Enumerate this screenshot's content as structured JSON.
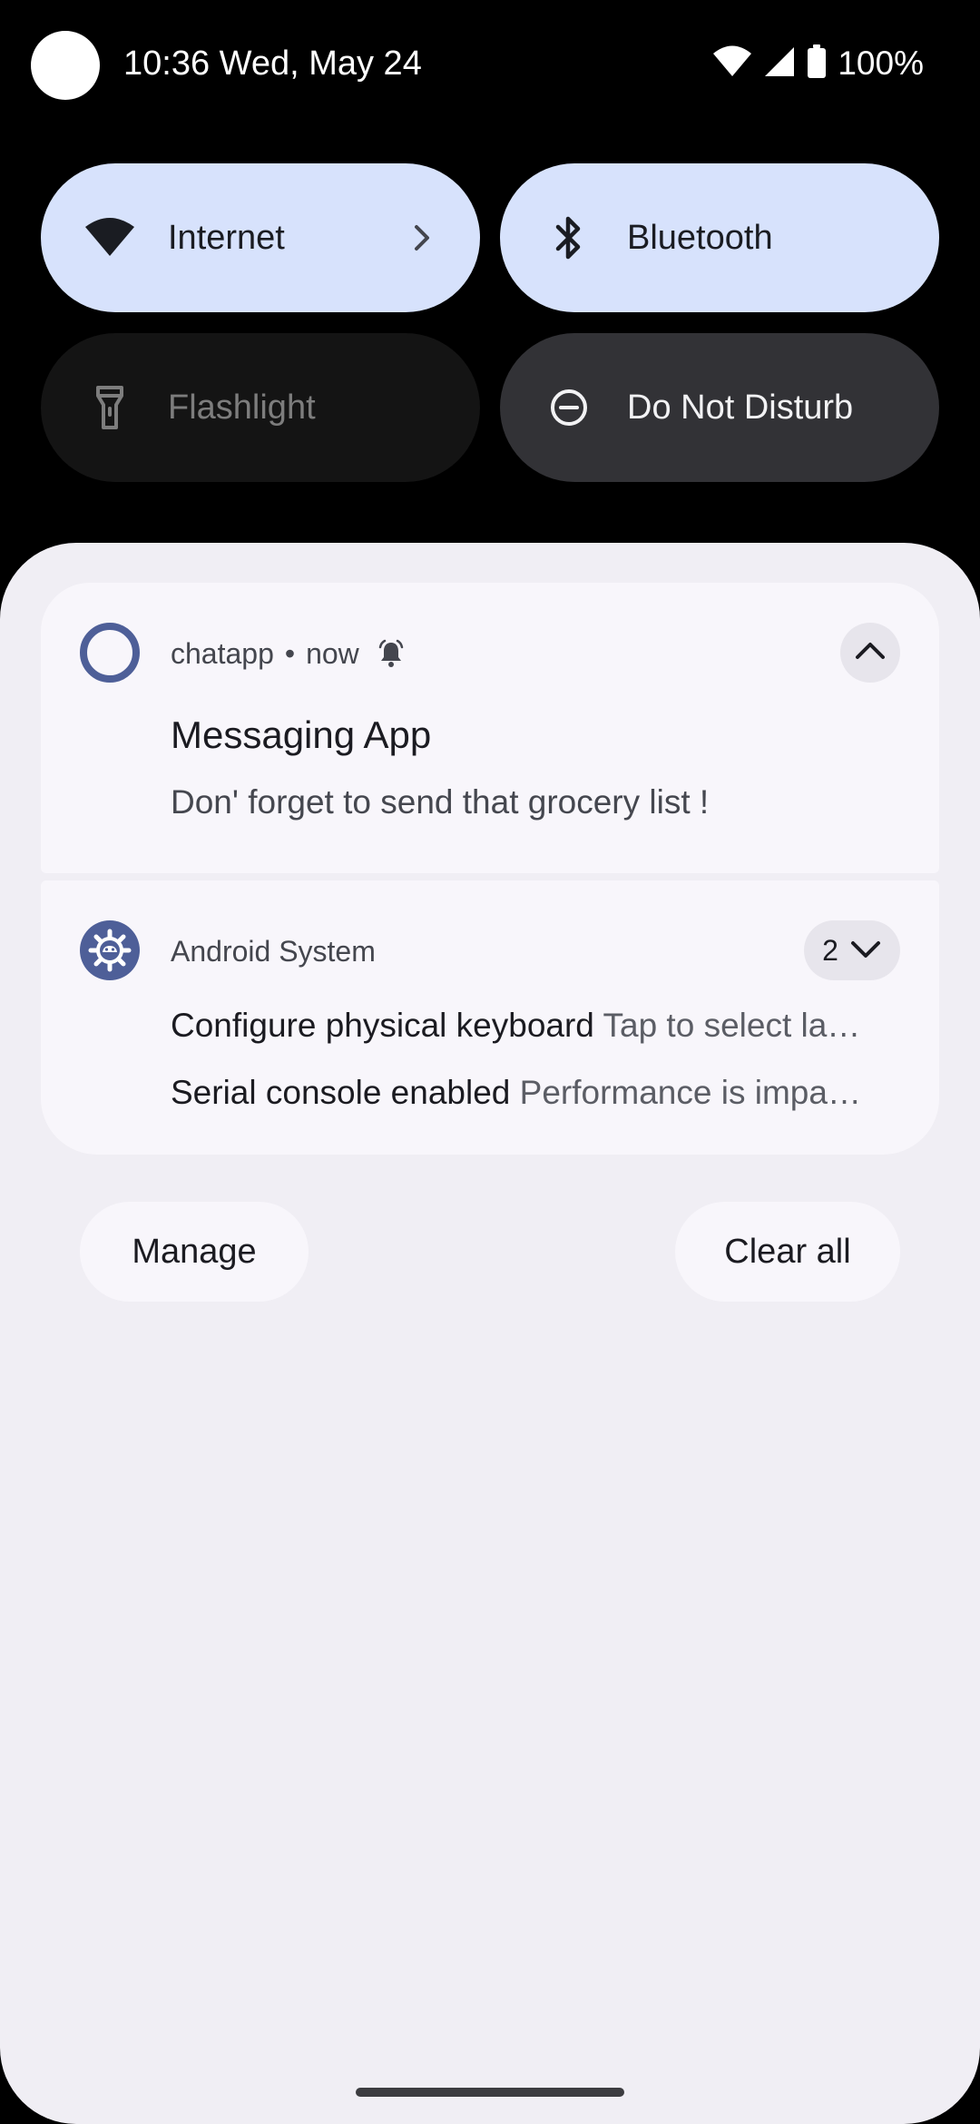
{
  "status_bar": {
    "clock": "10:36 Wed, May 24",
    "battery": "100%",
    "icons": [
      "wifi-icon",
      "cell-signal-icon",
      "battery-icon"
    ]
  },
  "quick_settings": {
    "tiles": [
      {
        "label": "Internet",
        "icon": "wifi-icon",
        "state": "on",
        "has_chevron": true
      },
      {
        "label": "Bluetooth",
        "icon": "bluetooth-icon",
        "state": "on"
      },
      {
        "label": "Flashlight",
        "icon": "flashlight-icon",
        "state": "off"
      },
      {
        "label": "Do Not Disturb",
        "icon": "do-not-disturb-icon",
        "state": "off"
      }
    ]
  },
  "notifications": {
    "chat": {
      "app": "chatapp",
      "separator": "•",
      "time": "now",
      "title": "Messaging App",
      "text": "Don' forget to send that grocery list !",
      "icon": "ring-app-icon",
      "alert_icon": "bell-icon",
      "expand_icon": "chevron-up-icon"
    },
    "system": {
      "app": "Android System",
      "count": "2",
      "icon": "gear-icon",
      "expand_icon": "chevron-down-icon",
      "items": [
        {
          "title": "Configure physical keyboard",
          "text": "Tap to select la…"
        },
        {
          "title": "Serial console enabled",
          "text": "Performance is impa…"
        }
      ]
    }
  },
  "actions": {
    "manage": "Manage",
    "clear_all": "Clear all"
  },
  "colors": {
    "accent_tile": "#d7e2fc",
    "app_icon": "#4e5f98",
    "shade_bg": "#f0eef4",
    "card_bg": "#f8f6fb"
  }
}
